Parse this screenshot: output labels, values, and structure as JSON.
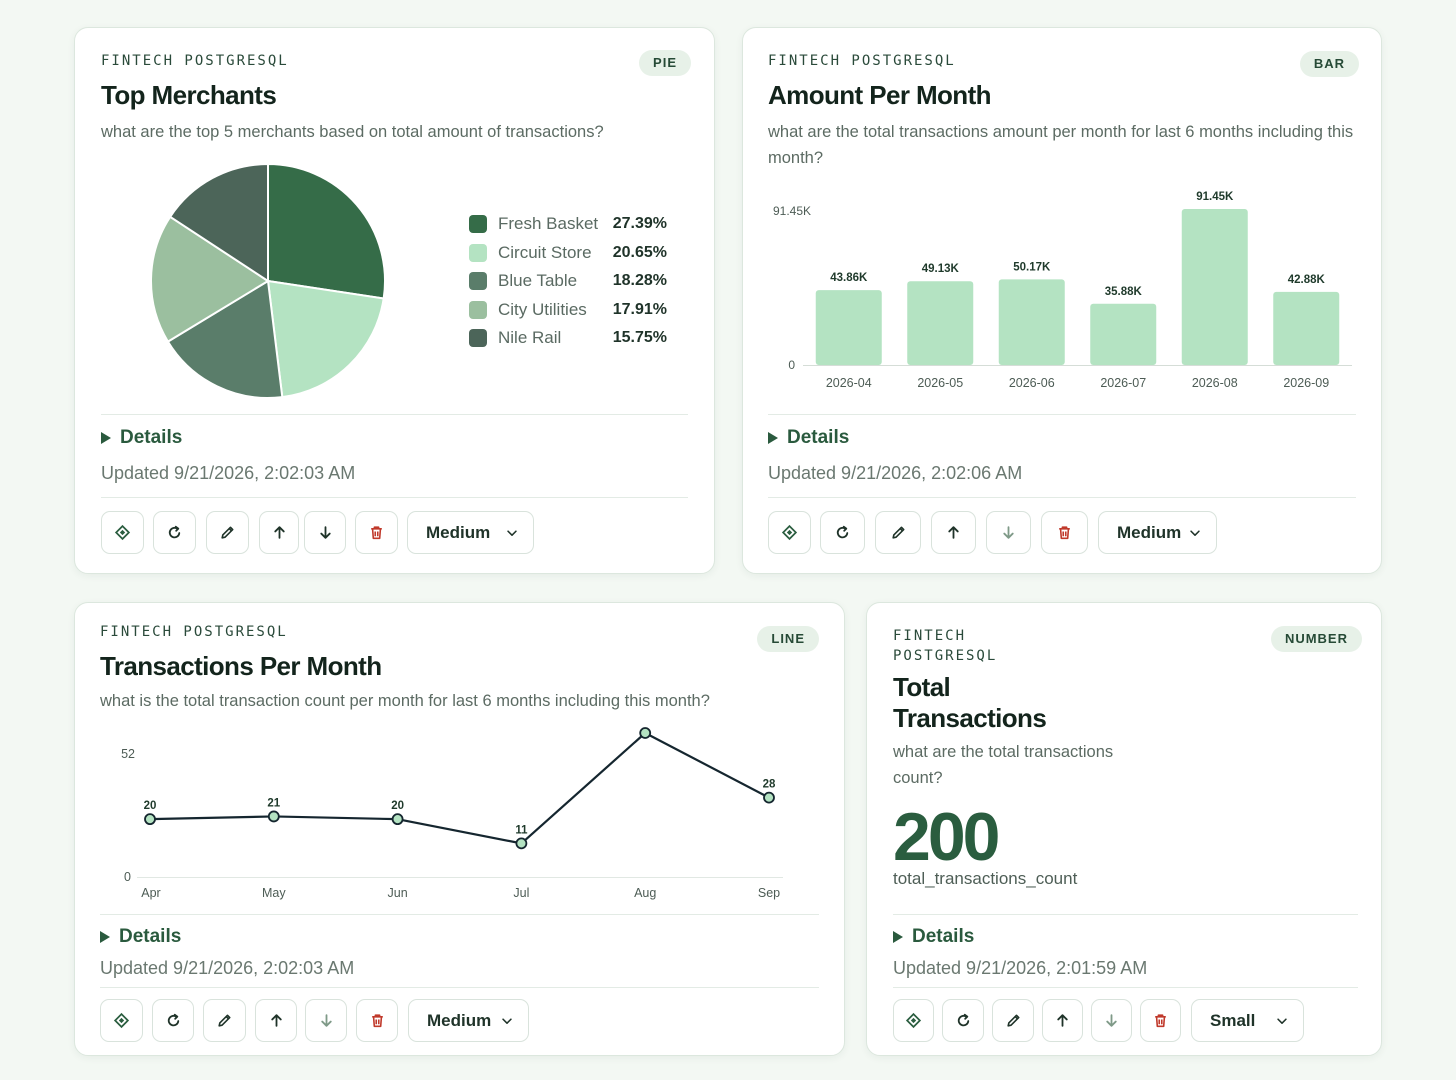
{
  "colors": {
    "accent": "#2a5d3f",
    "bar_fill": "#b4e3c2",
    "line": "#15262f",
    "delete": "#c0392b"
  },
  "cards": {
    "pie": {
      "source": "FINTECH POSTGRESQL",
      "badge": "PIE",
      "title": "Top Merchants",
      "question": "what are the top 5 merchants based on total amount of transactions?",
      "details_label": "Details",
      "updated": "Updated 9/21/2026, 2:02:03 AM",
      "size": "Medium"
    },
    "bar": {
      "source": "FINTECH POSTGRESQL",
      "badge": "BAR",
      "title": "Amount Per Month",
      "question": "what are the total transactions amount per month for last 6 months including this month?",
      "details_label": "Details",
      "updated": "Updated 9/21/2026, 2:02:06 AM",
      "size": "Medium"
    },
    "line": {
      "source": "FINTECH POSTGRESQL",
      "badge": "LINE",
      "title": "Transactions Per Month",
      "question": "what is the total transaction count per month for last 6 months including this month?",
      "details_label": "Details",
      "updated": "Updated 9/21/2026, 2:02:03 AM",
      "size": "Medium"
    },
    "number": {
      "source_line1": "FINTECH",
      "source_line2": "POSTGRESQL",
      "badge": "NUMBER",
      "title_line1": "Total",
      "title_line2": "Transactions",
      "question_line1": "what are the total transactions",
      "question_line2": "count?",
      "value": "200",
      "caption": "total_transactions_count",
      "details_label": "Details",
      "updated": "Updated 9/21/2026, 2:01:59 AM",
      "size": "Small"
    }
  },
  "toolbar_icons": [
    "pin-icon",
    "refresh-icon",
    "edit-icon",
    "arrow-up-icon",
    "arrow-down-icon",
    "trash-icon",
    "chevron-down-icon"
  ],
  "chart_data": [
    {
      "type": "pie",
      "title": "Top Merchants",
      "slices": [
        {
          "label": "Fresh Basket",
          "value": 27.39,
          "display": "27.39%",
          "color": "#356c48"
        },
        {
          "label": "Circuit Store",
          "value": 20.65,
          "display": "20.65%",
          "color": "#b4e3c2"
        },
        {
          "label": "Blue Table",
          "value": 18.28,
          "display": "18.28%",
          "color": "#5a7d6a"
        },
        {
          "label": "City Utilities",
          "value": 17.91,
          "display": "17.91%",
          "color": "#9bbf9f"
        },
        {
          "label": "Nile Rail",
          "value": 15.75,
          "display": "15.75%",
          "color": "#4c6559"
        }
      ]
    },
    {
      "type": "bar",
      "title": "Amount Per Month",
      "categories": [
        "2026-04",
        "2026-05",
        "2026-06",
        "2026-07",
        "2026-08",
        "2026-09"
      ],
      "values": [
        43.86,
        49.13,
        50.17,
        35.88,
        91.45,
        42.88
      ],
      "value_labels": [
        "43.86K",
        "49.13K",
        "50.17K",
        "35.88K",
        "91.45K",
        "42.88K"
      ],
      "ylim": [
        0,
        91.45
      ],
      "y_ticks": [
        "0",
        "91.45K"
      ],
      "grid": false
    },
    {
      "type": "line",
      "title": "Transactions Per Month",
      "categories": [
        "Apr",
        "May",
        "Jun",
        "Jul",
        "Aug",
        "Sep"
      ],
      "values": [
        20,
        21,
        20,
        11,
        52,
        28
      ],
      "ylim": [
        0,
        52
      ],
      "y_ticks": [
        "0",
        "52"
      ],
      "grid": false
    }
  ]
}
